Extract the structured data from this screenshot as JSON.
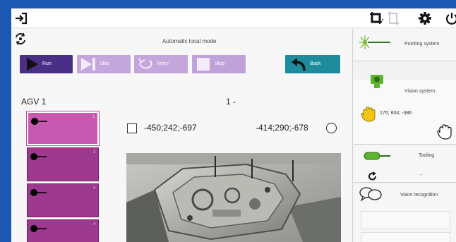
{
  "topbar": {
    "icons": [
      "exit-icon",
      "target-frame-icon",
      "frame-icon",
      "gear-icon",
      "power-icon"
    ]
  },
  "main": {
    "mode_title": "Automatic local mode",
    "buttons": {
      "run": "Run",
      "skip": "Skip",
      "retry": "Retry",
      "stop": "Stop",
      "back": "Back"
    },
    "agv_title": "AGV 1",
    "step_counter": "1 -",
    "agv_items": [
      "1",
      "2",
      "3",
      "4"
    ],
    "coord_left": "-450;242;-697",
    "coord_right": "-414;290;-678"
  },
  "right": {
    "pointing": {
      "title": "Pointing system"
    },
    "vision": {
      "title": "Vision system",
      "coords": "175; 604; -386"
    },
    "tooling": {
      "title": "Tooling",
      "value": "--"
    },
    "voice": {
      "title": "Voice recognition"
    }
  },
  "colors": {
    "frame": "#1b59b5",
    "run": "#4a2f86",
    "disabled": "#c3a6dc",
    "back": "#1d8d9e",
    "agv_item": "#9e3990",
    "agv_item_selected": "#c659b0"
  }
}
